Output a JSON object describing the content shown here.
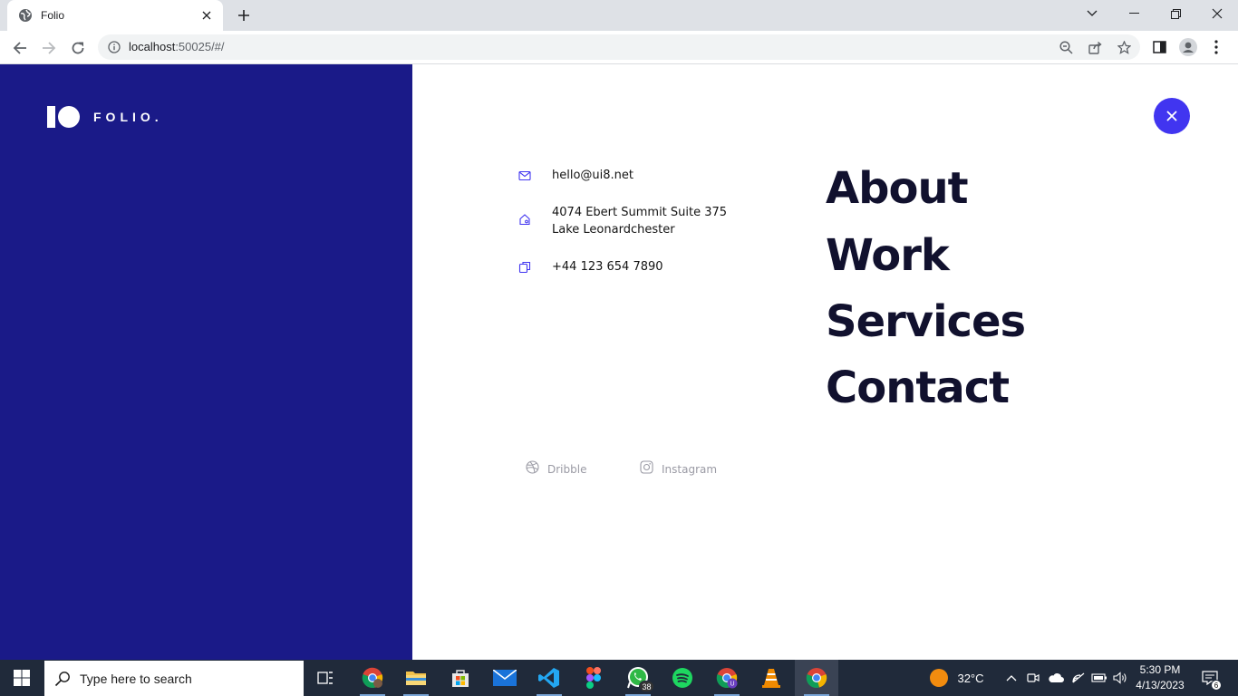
{
  "browser": {
    "tab_title": "Folio",
    "url_host": "localhost",
    "url_rest": ":50025/#/"
  },
  "page": {
    "logo_text": "FOLIO.",
    "contact": {
      "email": "hello@ui8.net",
      "address_line1": "4074 Ebert Summit Suite 375",
      "address_line2": "Lake Leonardchester",
      "phone": "+44 123 654 7890"
    },
    "menu": [
      "About",
      "Work",
      "Services",
      "Contact"
    ],
    "social": [
      {
        "label": "Dribble",
        "icon": "dribbble-icon"
      },
      {
        "label": "Instagram",
        "icon": "instagram-icon"
      }
    ],
    "colors": {
      "panel": "#1a1a88",
      "accent": "#4135f0",
      "menu_text": "#11112e"
    }
  },
  "taskbar": {
    "search_placeholder": "Type here to search",
    "whatsapp_badge": "38",
    "weather": "32°C",
    "time": "5:30 PM",
    "date": "4/13/2023",
    "notifications": "6"
  }
}
